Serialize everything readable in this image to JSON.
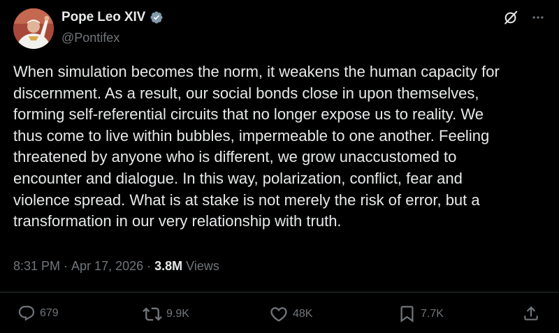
{
  "author": {
    "display_name": "Pope Leo XIV",
    "handle": "@Pontifex",
    "verified_color": "#829aab",
    "avatar_icon": "pope-portrait"
  },
  "tweet": {
    "text": "When simulation becomes the norm, it weakens the human capacity for\ndiscernment.  As a result, our social bonds close in upon themselves,\nforming self-referential circuits that no longer expose us to reality.  We\nthus come to live within bubbles, impermeable to one another.  Feeling\nthreatened by anyone who is different, we grow unaccustomed to\nencounter and dialogue.  In this way, polarization, conflict, fear and\nviolence spread.  What is at stake is not merely the risk of error, but a\ntransformation in our very relationship with truth."
  },
  "meta": {
    "time": "8:31 PM",
    "date": "Apr 17, 2026",
    "views_count": "3.8M",
    "views_label": "Views"
  },
  "actions": {
    "replies": "679",
    "reposts": "9.9K",
    "likes": "48K",
    "bookmarks": "7.7K"
  },
  "icons": {
    "top_right": [
      "grok-icon",
      "more-icon"
    ],
    "action_bar": [
      "reply-icon",
      "repost-icon",
      "like-icon",
      "bookmark-icon",
      "share-icon"
    ]
  },
  "colors": {
    "background": "#000000",
    "text": "#e7e9ea",
    "secondary": "#71767b",
    "divider": "#2f3336"
  }
}
